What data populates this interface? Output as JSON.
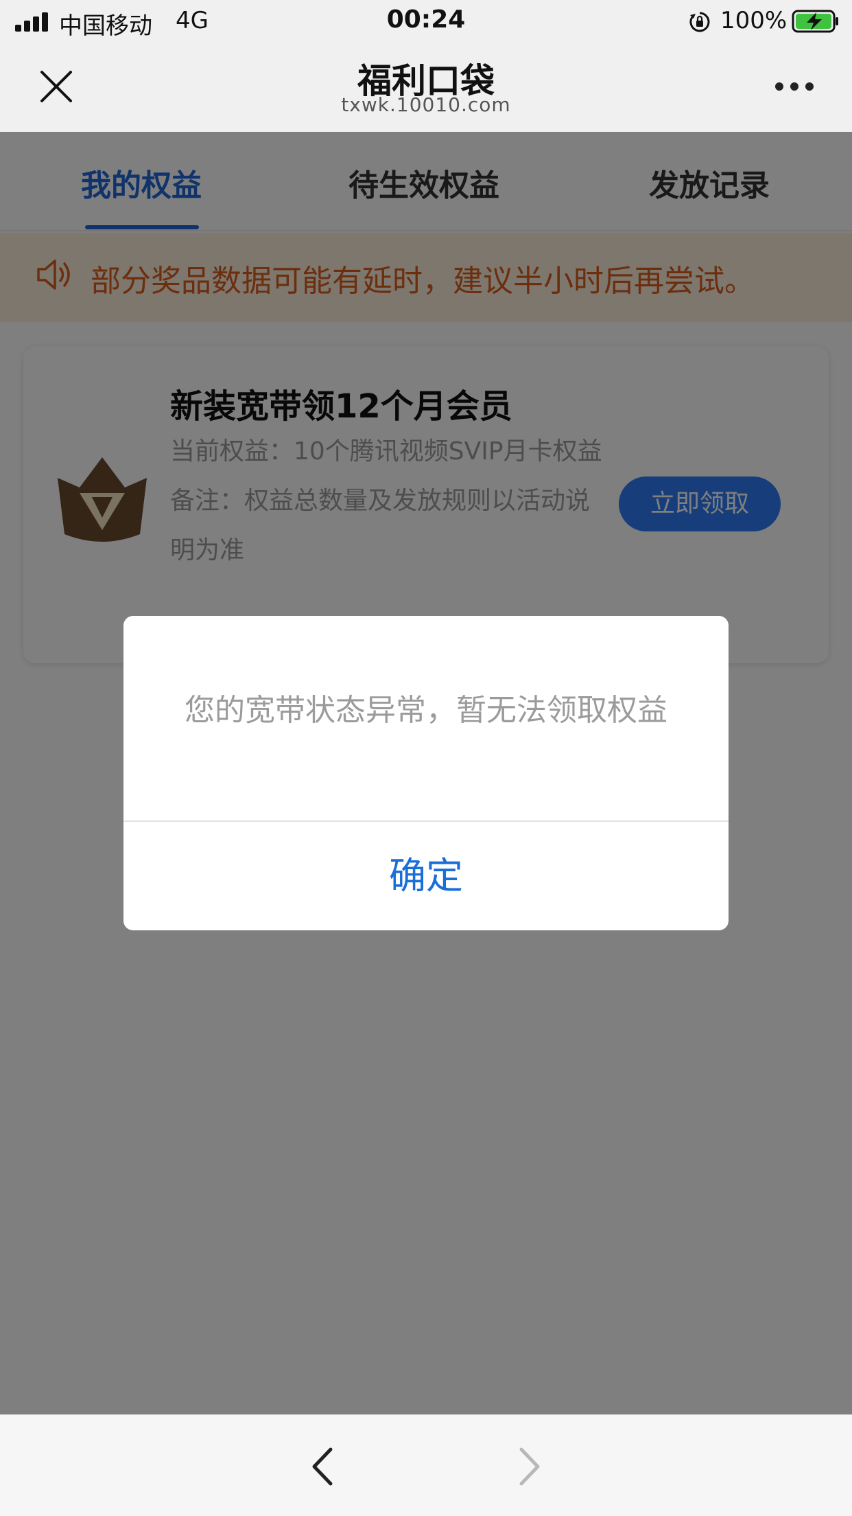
{
  "status_bar": {
    "carrier": "中国移动",
    "network": "4G",
    "time": "00:24",
    "battery": "100%",
    "icons": [
      "signal-icon",
      "orientation-lock-icon",
      "battery-charging-icon"
    ]
  },
  "nav": {
    "title": "福利口袋",
    "url": "txwk.10010.com",
    "icons": [
      "close-icon",
      "more-icon"
    ]
  },
  "tabs": [
    {
      "label": "我的权益",
      "active": true
    },
    {
      "label": "待生效权益",
      "active": false
    },
    {
      "label": "发放记录",
      "active": false
    }
  ],
  "notice": {
    "icon": "speaker-icon",
    "text": "部分奖品数据可能有延时，建议半小时后再尝试。"
  },
  "card": {
    "icon": "crown-icon",
    "title": "新装宽带领12个月会员",
    "benefit": "当前权益：10个腾讯视频SVIP月卡权益",
    "note": "备注：权益总数量及发放规则以活动说明为准",
    "button": "立即领取"
  },
  "dialog": {
    "message": "您的宽带状态异常，暂无法领取权益",
    "confirm": "确定"
  },
  "toolbar": {
    "icons": [
      "back-icon",
      "forward-icon"
    ]
  },
  "colors": {
    "accent": "#2266d6",
    "button": "#2f7df6",
    "notice_text": "#d95c1a",
    "notice_bg": "#fbeedd",
    "dialog_confirm": "#1a6ed8"
  }
}
